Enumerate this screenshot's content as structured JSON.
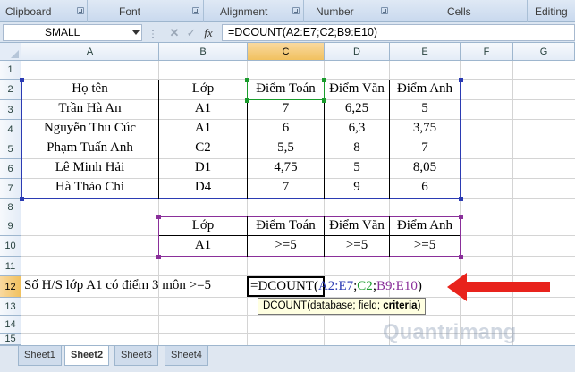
{
  "ribbon": {
    "groups": [
      "Clipboard",
      "Font",
      "Alignment",
      "Number",
      "Cells",
      "Editing"
    ]
  },
  "formula_bar": {
    "name_box": "SMALL",
    "fx_label": "fx",
    "formula": "=DCOUNT(A2:E7;C2;B9:E10)"
  },
  "columns": [
    "A",
    "B",
    "C",
    "D",
    "E",
    "F",
    "G"
  ],
  "rows": [
    "1",
    "2",
    "3",
    "4",
    "5",
    "6",
    "7",
    "8",
    "9",
    "10",
    "11",
    "12",
    "13",
    "14",
    "15"
  ],
  "database": {
    "headers": [
      "Họ tên",
      "Lớp",
      "Điểm Toán",
      "Điểm Văn",
      "Điểm Anh"
    ],
    "rows": [
      [
        "Trần Hà An",
        "A1",
        "7",
        "6,25",
        "5"
      ],
      [
        "Nguyễn Thu Cúc",
        "A1",
        "6",
        "6,3",
        "3,75"
      ],
      [
        "Phạm Tuấn Anh",
        "C2",
        "5,5",
        "8",
        "7"
      ],
      [
        "Lê Minh Hải",
        "D1",
        "4,75",
        "5",
        "8,05"
      ],
      [
        "Hà Thảo Chi",
        "D4",
        "7",
        "9",
        "6"
      ]
    ]
  },
  "criteria": {
    "headers": [
      "Lớp",
      "Điểm Toán",
      "Điểm Văn",
      "Điểm Anh"
    ],
    "values": [
      "A1",
      ">=5",
      ">=5",
      ">=5"
    ]
  },
  "question": "Số H/S lớp A1 có điểm 3 môn >=5",
  "cell_formula": {
    "prefix": "=DCOUNT(",
    "arg1": "A2:E7",
    "sep1": ";",
    "arg2": "C2",
    "sep2": ";",
    "arg3": "B9:E10",
    "suffix": ")"
  },
  "tooltip": {
    "prefix": "DCOUNT(database; field; ",
    "bold": "criteria",
    "suffix": ")"
  },
  "colors": {
    "range_database": "#2b3bb3",
    "range_field": "#1a9c2c",
    "range_criteria": "#8a2f9a",
    "arrow": "#e8231c"
  },
  "watermark": "Quantrimang",
  "sheet_tabs": [
    "Sheet1",
    "Sheet2",
    "Sheet3",
    "Sheet4"
  ]
}
